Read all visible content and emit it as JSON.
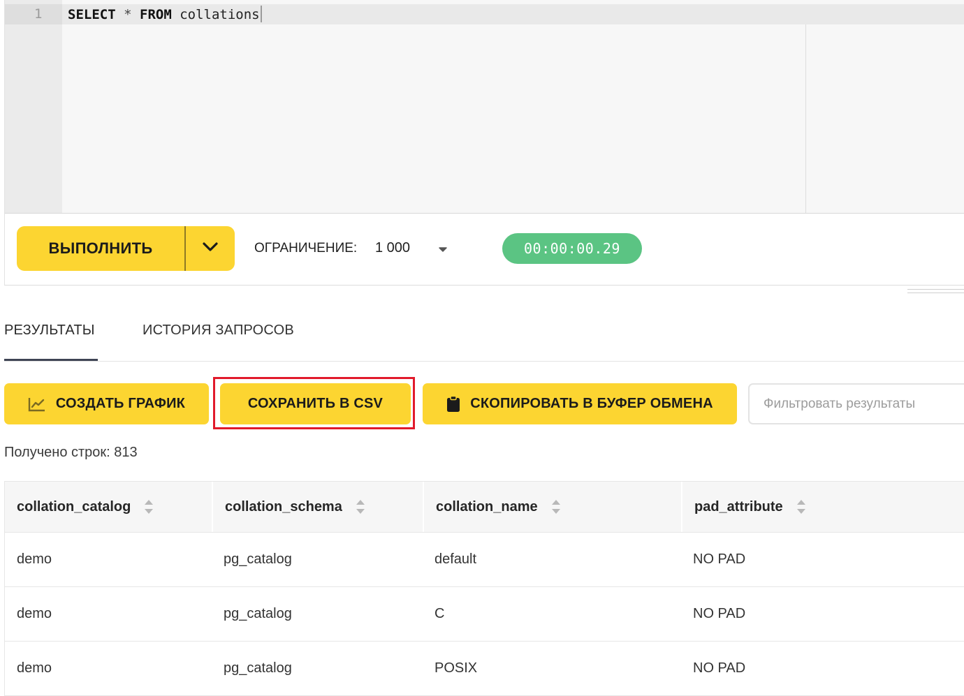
{
  "editor": {
    "line_number": "1",
    "query": {
      "kw1": "SELECT",
      "op": "*",
      "kw2": "FROM",
      "ident": "collations"
    }
  },
  "toolbar": {
    "run_label": "ВЫПОЛНИТЬ",
    "limit_label": "ОГРАНИЧЕНИЕ:",
    "limit_value": "1 000",
    "timer": "00:00:00.29"
  },
  "tabs": {
    "results": "РЕЗУЛЬТАТЫ",
    "history": "ИСТОРИЯ ЗАПРОСОВ"
  },
  "actions": {
    "chart": "СОЗДАТЬ ГРАФИК",
    "csv": "СОХРАНИТЬ В CSV",
    "copy": "СКОПИРОВАТЬ В БУФЕР ОБМЕНА",
    "filter_placeholder": "Фильтровать результаты"
  },
  "rows_count": "Получено строк: 813",
  "table": {
    "columns": [
      "collation_catalog",
      "collation_schema",
      "collation_name",
      "pad_attribute"
    ],
    "rows": [
      [
        "demo",
        "pg_catalog",
        "default",
        "NO PAD"
      ],
      [
        "demo",
        "pg_catalog",
        "C",
        "NO PAD"
      ],
      [
        "demo",
        "pg_catalog",
        "POSIX",
        "NO PAD"
      ]
    ]
  },
  "colors": {
    "accent": "#fcd531",
    "timer": "#5bc483",
    "highlight": "#e11a2b"
  },
  "icons": {
    "chart": "line-chart-icon",
    "copy": "clipboard-icon",
    "run_menu": "chevron-down-icon",
    "limit": "caret-down-icon",
    "sort": "sort-icon"
  }
}
